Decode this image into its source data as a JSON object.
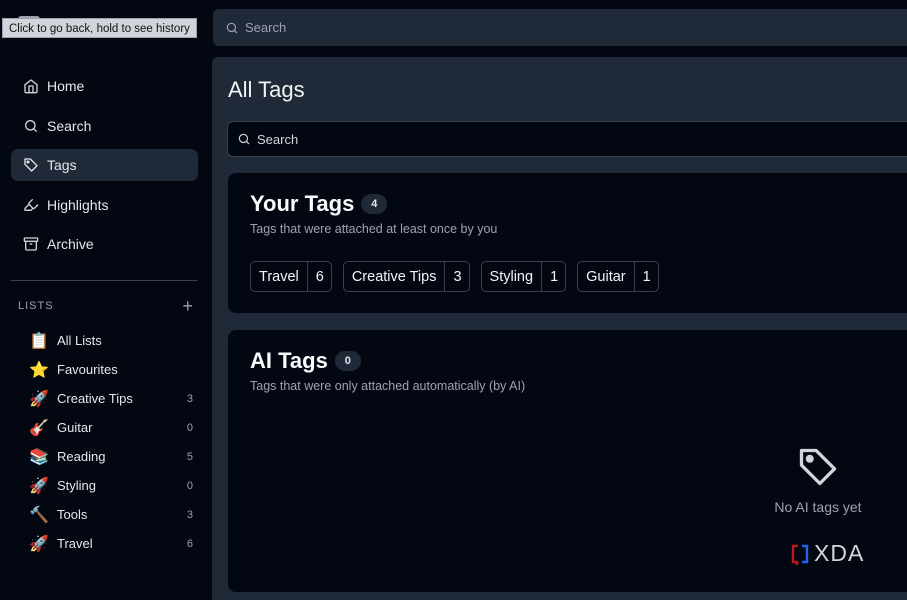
{
  "tooltip": "Click to go back, hold to see history",
  "top_search": {
    "placeholder": "Search"
  },
  "nav": [
    {
      "label": "Home",
      "icon": "home-icon"
    },
    {
      "label": "Search",
      "icon": "search-icon"
    },
    {
      "label": "Tags",
      "icon": "tag-icon",
      "active": true
    },
    {
      "label": "Highlights",
      "icon": "highlighter-icon"
    },
    {
      "label": "Archive",
      "icon": "archive-icon"
    }
  ],
  "lists_header": {
    "title": "LISTS",
    "add": "+"
  },
  "lists": [
    {
      "emoji": "📋",
      "name": "All Lists",
      "count": ""
    },
    {
      "emoji": "⭐",
      "name": "Favourites",
      "count": ""
    },
    {
      "emoji": "🚀",
      "name": "Creative Tips",
      "count": "3"
    },
    {
      "emoji": "🎸",
      "name": "Guitar",
      "count": "0"
    },
    {
      "emoji": "📚",
      "name": "Reading",
      "count": "5"
    },
    {
      "emoji": "🚀",
      "name": "Styling",
      "count": "0"
    },
    {
      "emoji": "🔨",
      "name": "Tools",
      "count": "3"
    },
    {
      "emoji": "🚀",
      "name": "Travel",
      "count": "6"
    }
  ],
  "main": {
    "title": "All Tags",
    "search_placeholder": "Search",
    "your_tags": {
      "title": "Your Tags",
      "count": "4",
      "subtitle": "Tags that were attached at least once by you",
      "tags": [
        {
          "name": "Travel",
          "count": "6"
        },
        {
          "name": "Creative Tips",
          "count": "3"
        },
        {
          "name": "Styling",
          "count": "1"
        },
        {
          "name": "Guitar",
          "count": "1"
        }
      ]
    },
    "ai_tags": {
      "title": "AI Tags",
      "count": "0",
      "subtitle": "Tags that were only attached automatically (by AI)",
      "empty_text": "No AI tags yet"
    }
  },
  "watermark": "XDA",
  "colors": {
    "background": "#030712",
    "panel": "#1f2937",
    "border": "#374151",
    "muted_text": "#9ca3af"
  }
}
